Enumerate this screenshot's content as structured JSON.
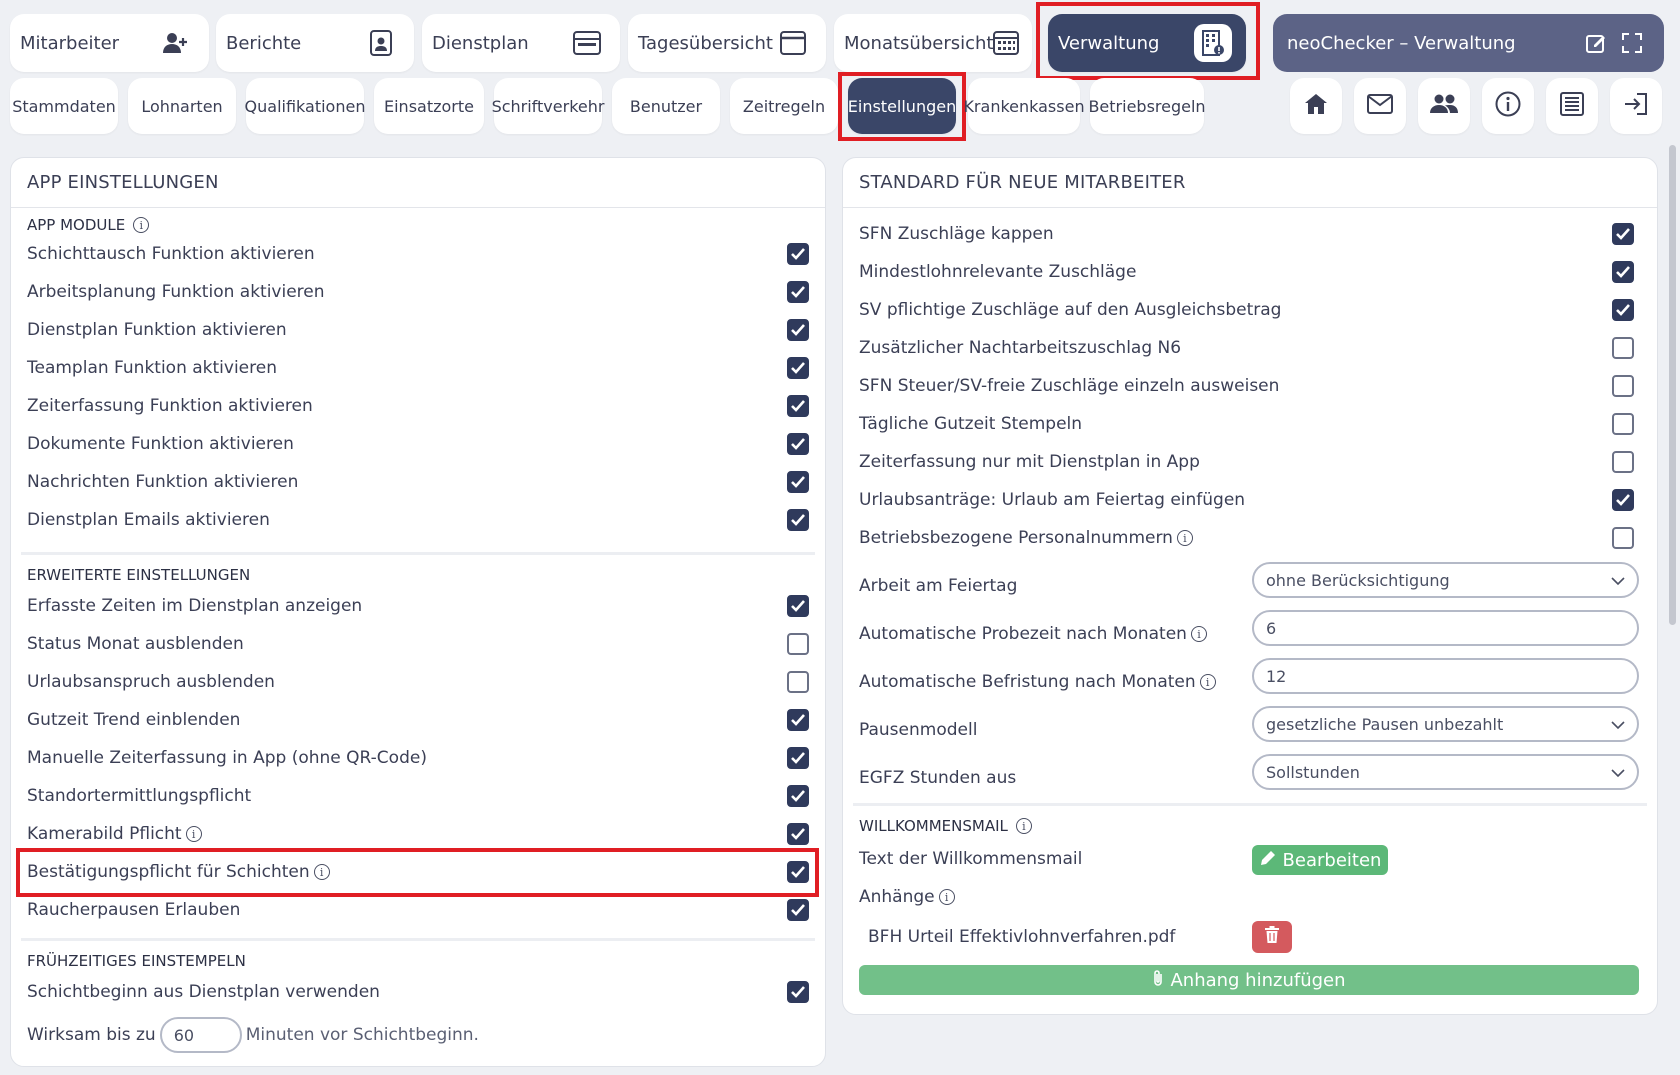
{
  "top_nav": [
    {
      "label": "Mitarbeiter",
      "icon": "user-plus-icon"
    },
    {
      "label": "Berichte",
      "icon": "report-icon"
    },
    {
      "label": "Dienstplan",
      "icon": "schedule-icon"
    },
    {
      "label": "Tagesübersicht",
      "icon": "calendar-day-icon"
    },
    {
      "label": "Monatsübersicht",
      "icon": "calendar-month-icon"
    },
    {
      "label": "Verwaltung",
      "icon": "building-icon",
      "active": true
    }
  ],
  "title_card": {
    "label": "neoChecker – Verwaltung"
  },
  "sub_nav": [
    {
      "label": "Stammdaten"
    },
    {
      "label": "Lohnarten"
    },
    {
      "label": "Qualifikationen"
    },
    {
      "label": "Einsatzorte"
    },
    {
      "label": "Schriftverkehr"
    },
    {
      "label": "Benutzer"
    },
    {
      "label": "Zeitregeln"
    },
    {
      "label": "Einstellungen",
      "active": true
    },
    {
      "label": "Krankenkassen"
    },
    {
      "label": "Betriebsregeln"
    }
  ],
  "icon_bar": [
    "home-icon",
    "mail-icon",
    "users-icon",
    "info-icon",
    "document-icon",
    "logout-icon"
  ],
  "left_panel": {
    "title": "APP EINSTELLUNGEN",
    "section_modules": "APP MODULE",
    "modules": [
      {
        "label": "Schichttausch Funktion aktivieren",
        "checked": true
      },
      {
        "label": "Arbeitsplanung Funktion aktivieren",
        "checked": true
      },
      {
        "label": "Dienstplan Funktion aktivieren",
        "checked": true
      },
      {
        "label": "Teamplan Funktion aktivieren",
        "checked": true
      },
      {
        "label": "Zeiterfassung Funktion aktivieren",
        "checked": true
      },
      {
        "label": "Dokumente Funktion aktivieren",
        "checked": true
      },
      {
        "label": "Nachrichten Funktion aktivieren",
        "checked": true
      },
      {
        "label": "Dienstplan Emails aktivieren",
        "checked": true
      }
    ],
    "section_advanced": "ERWEITERTE EINSTELLUNGEN",
    "advanced": [
      {
        "label": "Erfasste Zeiten im Dienstplan anzeigen",
        "checked": true
      },
      {
        "label": "Status Monat ausblenden",
        "checked": false
      },
      {
        "label": "Urlaubsanspruch ausblenden",
        "checked": false
      },
      {
        "label": "Gutzeit Trend einblenden",
        "checked": true
      },
      {
        "label": "Manuelle Zeiterfassung in App (ohne QR-Code)",
        "checked": true
      },
      {
        "label": "Standortermittlungspflicht",
        "checked": true
      },
      {
        "label": "Kamerabild Pflicht",
        "checked": true,
        "info": true
      },
      {
        "label": "Bestätigungspflicht für Schichten",
        "checked": true,
        "info": true
      },
      {
        "label": "Raucherpausen Erlauben",
        "checked": true
      }
    ],
    "section_early": "FRÜHZEITIGES EINSTEMPELN",
    "early": {
      "label": "Schichtbeginn aus Dienstplan verwenden",
      "checked": true
    },
    "effective_prefix": "Wirksam bis zu",
    "effective_value": "60",
    "effective_suffix": "Minuten vor Schichtbeginn."
  },
  "right_panel": {
    "title": "STANDARD FÜR NEUE MITARBEITER",
    "toggles": [
      {
        "label": "SFN Zuschläge kappen",
        "checked": true
      },
      {
        "label": "Mindestlohnrelevante Zuschläge",
        "checked": true
      },
      {
        "label": "SV pflichtige Zuschläge auf den Ausgleichsbetrag",
        "checked": true
      },
      {
        "label": "Zusätzlicher Nachtarbeitszuschlag N6",
        "checked": false
      },
      {
        "label": "SFN Steuer/SV-freie Zuschläge einzeln ausweisen",
        "checked": false
      },
      {
        "label": "Tägliche Gutzeit Stempeln",
        "checked": false
      },
      {
        "label": "Zeiterfassung nur mit Dienstplan in App",
        "checked": false
      },
      {
        "label": "Urlaubsanträge: Urlaub am Feiertag einfügen",
        "checked": true
      },
      {
        "label": "Betriebsbezogene Personalnummern",
        "checked": false,
        "info": true
      }
    ],
    "fields": [
      {
        "label": "Arbeit am Feiertag",
        "value": "ohne Berücksichtigung",
        "type": "select"
      },
      {
        "label": "Automatische Probezeit nach Monaten",
        "value": "6",
        "type": "input",
        "info": true
      },
      {
        "label": "Automatische Befristung nach Monaten",
        "value": "12",
        "type": "input",
        "info": true
      },
      {
        "label": "Pausenmodell",
        "value": "gesetzliche Pausen unbezahlt",
        "type": "select"
      },
      {
        "label": "EGFZ Stunden aus",
        "value": "Sollstunden",
        "type": "select"
      }
    ],
    "section_welcome": "WILLKOMMENSMAIL",
    "welcome_text_label": "Text der Willkommensmail",
    "edit_button": "Bearbeiten",
    "attachments_label": "Anhänge",
    "attachment_file": "BFH Urteil Effektivlohnverfahren.pdf",
    "add_attachment": "Anhang hinzufügen"
  },
  "colors": {
    "active_nav": "#3a4668",
    "highlight": "#e01e24",
    "green": "#5cb878",
    "red": "#d45a5e"
  }
}
